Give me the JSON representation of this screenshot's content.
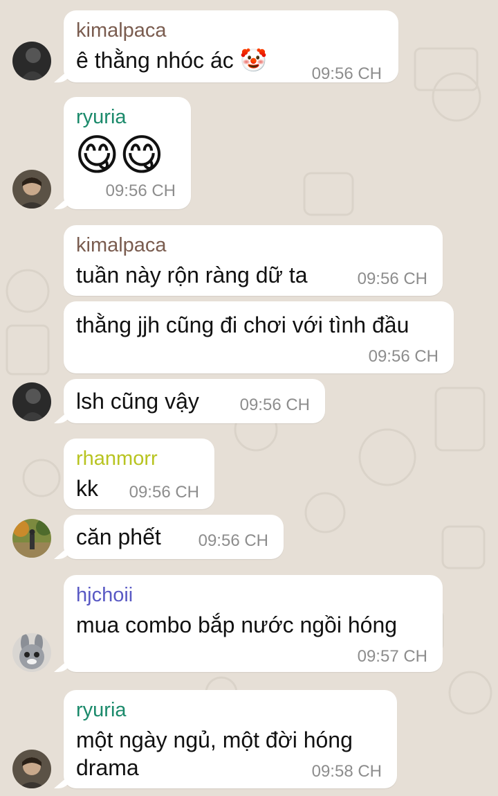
{
  "colors": {
    "kimalpaca": "#7a5c4f",
    "ryuria": "#1b8a6b",
    "rhanmorr": "#b8c421",
    "hjchoii": "#5959c4",
    "time": "#8d8d8d",
    "background": "#e6dfd6"
  },
  "messages": [
    {
      "sender": "kimalpaca",
      "text": "ê thằng nhóc ác 🤡",
      "time": "09:56 CH",
      "avatar": "avatar-kimalpaca"
    },
    {
      "sender": "ryuria",
      "text": "😋😋",
      "time": "09:56 CH",
      "avatar": "avatar-ryuria"
    },
    {
      "sender": "kimalpaca",
      "text": "tuần này rộn ràng dữ ta",
      "time": "09:56 CH"
    },
    {
      "text": "thằng jjh cũng đi chơi với tình đầu",
      "time": "09:56 CH"
    },
    {
      "text": "lsh cũng vậy",
      "time": "09:56 CH",
      "avatar": "avatar-kimalpaca"
    },
    {
      "sender": "rhanmorr",
      "text": "kk",
      "time": "09:56 CH"
    },
    {
      "text": "căn phết",
      "time": "09:56 CH",
      "avatar": "avatar-rhanmorr"
    },
    {
      "sender": "hjchoii",
      "text": "mua combo bắp nước ngồi hóng",
      "time": "09:57 CH",
      "avatar": "avatar-hjchoii"
    },
    {
      "sender": "ryuria",
      "text_line1": "một ngày ngủ, một đời hóng",
      "text_line2": "drama",
      "time": "09:58 CH",
      "avatar": "avatar-ryuria"
    }
  ]
}
